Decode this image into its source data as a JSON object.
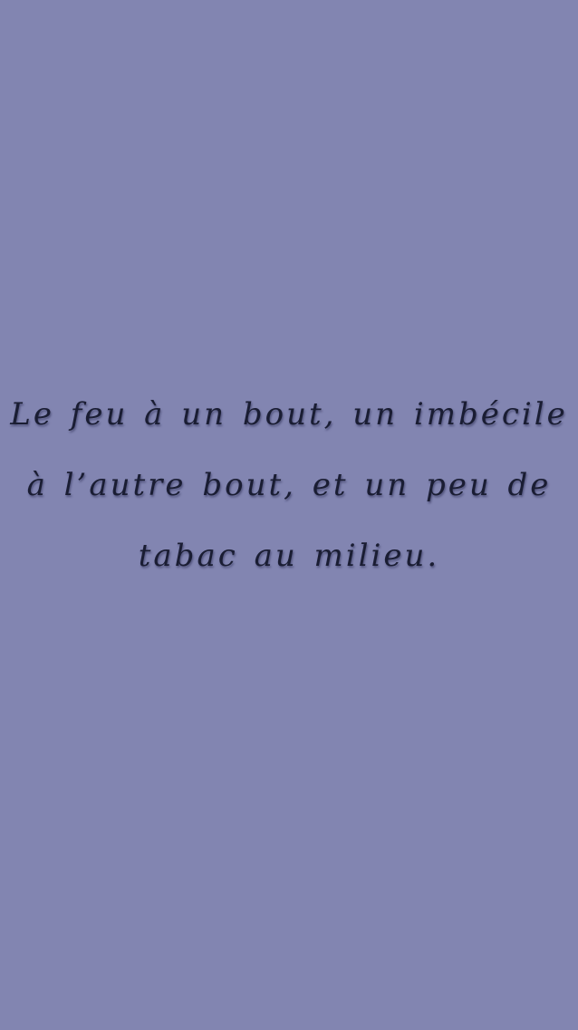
{
  "background_color": "#8285b1",
  "text_color": "#1a1d33",
  "quote": {
    "lines": [
      "Le feu à un bout, un imbécile",
      "à l’autre bout, et un peu de",
      "tabac au milieu."
    ]
  }
}
